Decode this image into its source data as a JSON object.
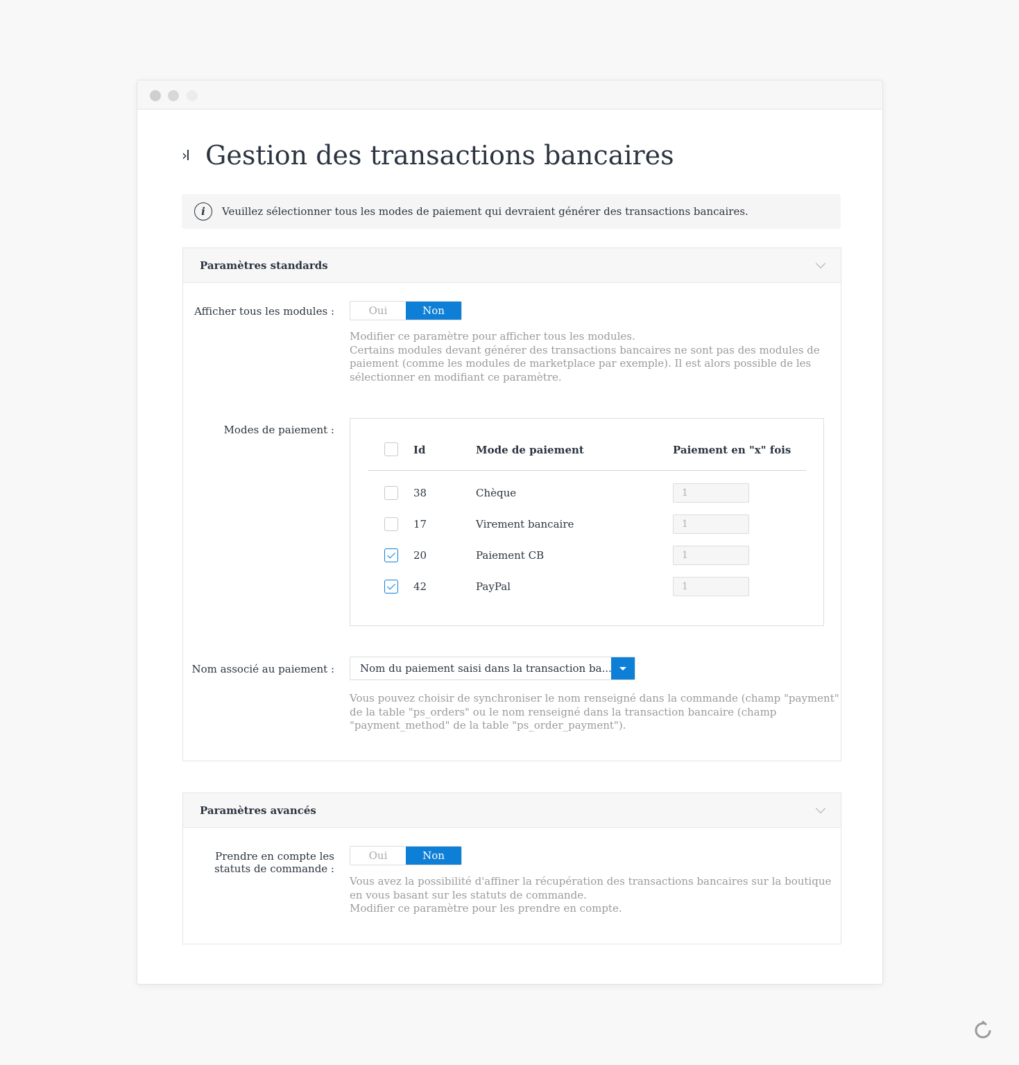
{
  "window": {
    "controls": [
      "close",
      "minimize",
      "maximize"
    ]
  },
  "page": {
    "title_icon": "›I",
    "title": "Gestion des transactions bancaires"
  },
  "info": {
    "icon": "info-icon",
    "text": "Veuillez sélectionner tous les modes de paiement qui devraient générer des transactions bancaires."
  },
  "standard": {
    "title": "Paramètres standards",
    "show_all": {
      "label": "Afficher tous les modules :",
      "yes": "Oui",
      "no": "Non",
      "selected": "Non",
      "help1": "Modifier ce paramètre pour afficher tous les modules.",
      "help2": "Certains modules devant générer des transactions bancaires ne sont pas des modules de",
      "help3": "paiement (comme les modules de marketplace par exemple). Il est alors possible de les",
      "help4": "sélectionner en modifiant ce paramètre."
    },
    "payment_modes": {
      "label": "Modes de paiement :",
      "columns": {
        "id": "Id",
        "mode": "Mode de paiement",
        "times": "Paiement en \"x\" fois"
      },
      "rows": [
        {
          "id": "38",
          "name": "Chèque",
          "checked": false,
          "times": "1"
        },
        {
          "id": "17",
          "name": "Virement bancaire",
          "checked": false,
          "times": "1"
        },
        {
          "id": "20",
          "name": "Paiement CB",
          "checked": true,
          "times": "1"
        },
        {
          "id": "42",
          "name": "PayPal",
          "checked": true,
          "times": "1"
        }
      ]
    },
    "payment_name": {
      "label": "Nom associé au paiement :",
      "value": "Nom du paiement saisi dans la transaction ba...",
      "help1": "Vous pouvez choisir de synchroniser le nom renseigné dans la commande (champ \"payment\"",
      "help2": "de la table \"ps_orders\" ou le nom renseigné dans la transaction bancaire (champ",
      "help3": "\"payment_method\" de la table \"ps_order_payment\")."
    }
  },
  "advanced": {
    "title": "Paramètres avancés",
    "order_status": {
      "label1": "Prendre en compte les",
      "label2": "statuts de commande :",
      "yes": "Oui",
      "no": "Non",
      "selected": "Non",
      "help1": "Vous avez la possibilité d'affiner la récupération des transactions bancaires sur la boutique",
      "help2": "en vous basant sur les statuts de commande.",
      "help3": "Modifier ce paramètre pour les prendre en compte."
    }
  },
  "colors": {
    "accent": "#0e7fd6",
    "text": "#2b3440",
    "muted": "#9a9a9a"
  }
}
